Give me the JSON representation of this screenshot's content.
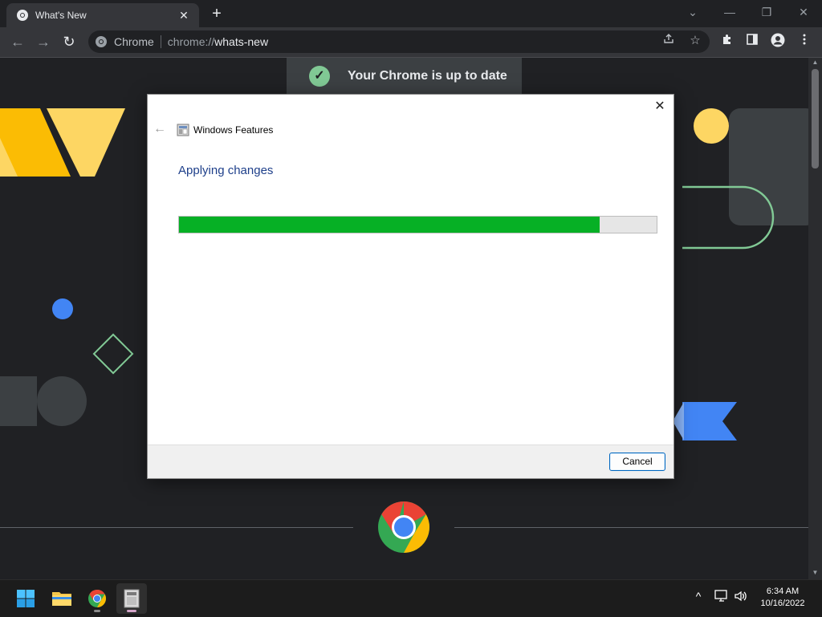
{
  "browser": {
    "tab_title": "What's New",
    "tab_close": "✕",
    "new_tab": "+",
    "window_controls": {
      "minimize_chevron": "⌄",
      "minimize": "—",
      "restore": "❐",
      "close": "✕"
    },
    "nav": {
      "back": "←",
      "forward": "→",
      "reload": "↻"
    },
    "omnibox": {
      "site_label": "Chrome",
      "url_scheme": "chrome://",
      "url_host": "whats-new"
    },
    "icons": [
      "share-icon",
      "star-icon",
      "extensions-icon",
      "side-panel-icon",
      "profile-icon",
      "menu-icon"
    ]
  },
  "page": {
    "banner_text": "Your Chrome is up to date"
  },
  "dialog": {
    "app_title": "Windows Features",
    "heading": "Applying changes",
    "progress_fraction": 0.88,
    "cancel_label": "Cancel",
    "close": "✕",
    "back": "←"
  },
  "taskbar": {
    "time": "6:34 AM",
    "date": "10/16/2022",
    "tray_chevron": "^"
  },
  "colors": {
    "progress_green": "#06b025",
    "dialog_heading": "#1e3f8a",
    "page_background": "#202124"
  }
}
